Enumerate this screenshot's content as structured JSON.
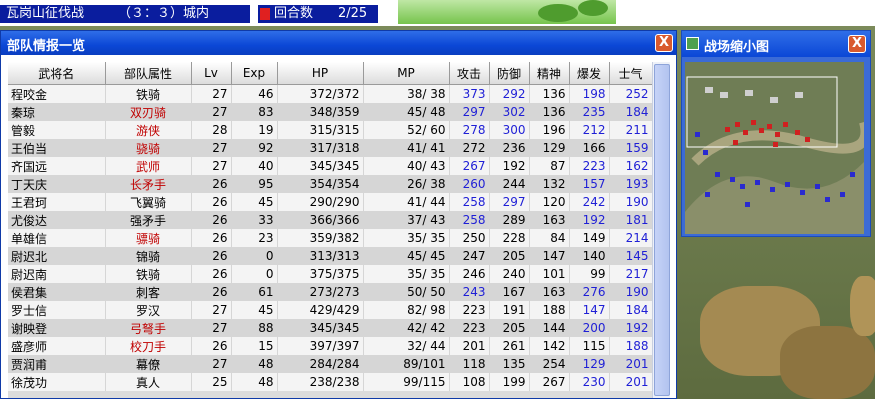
{
  "top_bar": {
    "battle_name": "瓦岗山征伐战",
    "battle_status": "（３：３）城内",
    "round_label": "回合数",
    "round_value": "2/25"
  },
  "troop_window": {
    "title": "部队情报一览",
    "close_label": "X",
    "columns": [
      "武将名",
      "部队属性",
      "Lv",
      "Exp",
      "HP",
      "MP",
      "攻击",
      "防御",
      "精神",
      "爆发",
      "士气"
    ],
    "rows": [
      {
        "name": "程咬金",
        "attr": "铁骑",
        "attr_red": false,
        "lv": "27",
        "exp": "46",
        "hp": "372/372",
        "mp": "38/ 38",
        "atk": "373",
        "atk_blue": true,
        "def": "292",
        "def_blue": true,
        "spi": "136",
        "burst": "198",
        "burst_blue": true,
        "morale": "252",
        "morale_blue": true
      },
      {
        "name": "秦琼",
        "attr": "双刃骑",
        "attr_red": true,
        "lv": "27",
        "exp": "83",
        "hp": "348/359",
        "mp": "45/ 48",
        "atk": "297",
        "atk_blue": true,
        "def": "302",
        "def_blue": true,
        "spi": "136",
        "burst": "235",
        "burst_blue": true,
        "morale": "184",
        "morale_blue": true
      },
      {
        "name": "管毅",
        "attr": "游侠",
        "attr_red": true,
        "lv": "28",
        "exp": "19",
        "hp": "315/315",
        "mp": "52/ 60",
        "atk": "278",
        "atk_blue": true,
        "def": "300",
        "def_blue": true,
        "spi": "196",
        "burst": "212",
        "burst_blue": true,
        "morale": "211",
        "morale_blue": true
      },
      {
        "name": "王伯当",
        "attr": "骁骑",
        "attr_red": true,
        "lv": "27",
        "exp": "92",
        "hp": "317/318",
        "mp": "41/ 41",
        "atk": "272",
        "atk_blue": false,
        "def": "236",
        "def_blue": false,
        "spi": "129",
        "burst": "166",
        "burst_blue": false,
        "morale": "159",
        "morale_blue": true
      },
      {
        "name": "齐国远",
        "attr": "武师",
        "attr_red": true,
        "lv": "27",
        "exp": "40",
        "hp": "345/345",
        "mp": "40/ 43",
        "atk": "267",
        "atk_blue": true,
        "def": "192",
        "def_blue": false,
        "spi": "87",
        "burst": "223",
        "burst_blue": true,
        "morale": "162",
        "morale_blue": true
      },
      {
        "name": "丁天庆",
        "attr": "长矛手",
        "attr_red": true,
        "lv": "26",
        "exp": "95",
        "hp": "354/354",
        "mp": "26/ 38",
        "atk": "260",
        "atk_blue": true,
        "def": "244",
        "def_blue": false,
        "spi": "132",
        "burst": "157",
        "burst_blue": true,
        "morale": "193",
        "morale_blue": true
      },
      {
        "name": "王君珂",
        "attr": "飞翼骑",
        "attr_red": false,
        "lv": "26",
        "exp": "45",
        "hp": "290/290",
        "mp": "41/ 44",
        "atk": "258",
        "atk_blue": true,
        "def": "297",
        "def_blue": true,
        "spi": "120",
        "burst": "242",
        "burst_blue": true,
        "morale": "190",
        "morale_blue": true
      },
      {
        "name": "尤俊达",
        "attr": "强矛手",
        "attr_red": false,
        "lv": "26",
        "exp": "33",
        "hp": "366/366",
        "mp": "37/ 43",
        "atk": "258",
        "atk_blue": true,
        "def": "289",
        "def_blue": false,
        "spi": "163",
        "burst": "192",
        "burst_blue": true,
        "morale": "181",
        "morale_blue": true
      },
      {
        "name": "单雄信",
        "attr": "骠骑",
        "attr_red": true,
        "lv": "26",
        "exp": "23",
        "hp": "359/382",
        "mp": "35/ 35",
        "atk": "250",
        "atk_blue": false,
        "def": "228",
        "def_blue": false,
        "spi": "84",
        "burst": "149",
        "burst_blue": false,
        "morale": "214",
        "morale_blue": true
      },
      {
        "name": "尉迟北",
        "attr": "锦骑",
        "attr_red": false,
        "lv": "26",
        "exp": "0",
        "hp": "313/313",
        "mp": "45/ 45",
        "atk": "247",
        "atk_blue": false,
        "def": "205",
        "def_blue": false,
        "spi": "147",
        "burst": "140",
        "burst_blue": false,
        "morale": "145",
        "morale_blue": true
      },
      {
        "name": "尉迟南",
        "attr": "铁骑",
        "attr_red": false,
        "lv": "26",
        "exp": "0",
        "hp": "375/375",
        "mp": "35/ 35",
        "atk": "246",
        "atk_blue": false,
        "def": "240",
        "def_blue": false,
        "spi": "101",
        "burst": "99",
        "burst_blue": false,
        "morale": "217",
        "morale_blue": true
      },
      {
        "name": "侯君集",
        "attr": "刺客",
        "attr_red": false,
        "lv": "26",
        "exp": "61",
        "hp": "273/273",
        "mp": "50/ 50",
        "atk": "243",
        "atk_blue": true,
        "def": "167",
        "def_blue": false,
        "spi": "163",
        "burst": "276",
        "burst_blue": true,
        "morale": "190",
        "morale_blue": true
      },
      {
        "name": "罗士信",
        "attr": "罗汉",
        "attr_red": false,
        "lv": "27",
        "exp": "45",
        "hp": "429/429",
        "mp": "82/ 98",
        "atk": "223",
        "atk_blue": false,
        "def": "191",
        "def_blue": false,
        "spi": "188",
        "burst": "147",
        "burst_blue": true,
        "morale": "184",
        "morale_blue": true
      },
      {
        "name": "谢映登",
        "attr": "弓弩手",
        "attr_red": true,
        "lv": "27",
        "exp": "88",
        "hp": "345/345",
        "mp": "42/ 42",
        "atk": "223",
        "atk_blue": false,
        "def": "205",
        "def_blue": false,
        "spi": "144",
        "burst": "200",
        "burst_blue": true,
        "morale": "192",
        "morale_blue": true
      },
      {
        "name": "盛彦师",
        "attr": "校刀手",
        "attr_red": true,
        "lv": "26",
        "exp": "15",
        "hp": "397/397",
        "mp": "32/ 44",
        "atk": "201",
        "atk_blue": false,
        "def": "261",
        "def_blue": false,
        "spi": "142",
        "burst": "115",
        "burst_blue": false,
        "morale": "188",
        "morale_blue": true
      },
      {
        "name": "贾润甫",
        "attr": "幕僚",
        "attr_red": false,
        "lv": "27",
        "exp": "48",
        "hp": "284/284",
        "mp": "89/101",
        "atk": "118",
        "atk_blue": false,
        "def": "135",
        "def_blue": false,
        "spi": "254",
        "burst": "129",
        "burst_blue": true,
        "morale": "201",
        "morale_blue": true
      },
      {
        "name": "徐茂功",
        "attr": "真人",
        "attr_red": false,
        "lv": "25",
        "exp": "48",
        "hp": "238/238",
        "mp": "99/115",
        "atk": "108",
        "atk_blue": false,
        "def": "199",
        "def_blue": false,
        "spi": "267",
        "burst": "230",
        "burst_blue": true,
        "morale": "201",
        "morale_blue": true
      }
    ]
  },
  "minimap_window": {
    "title": "战场缩小图",
    "close_label": "X"
  },
  "colors": {
    "titlebar_blue": "#0b47d6",
    "close_orange": "#d95a2e",
    "text_red": "#c00000",
    "text_blue": "#1f1fd6",
    "status_blue": "#0a1d9e"
  }
}
